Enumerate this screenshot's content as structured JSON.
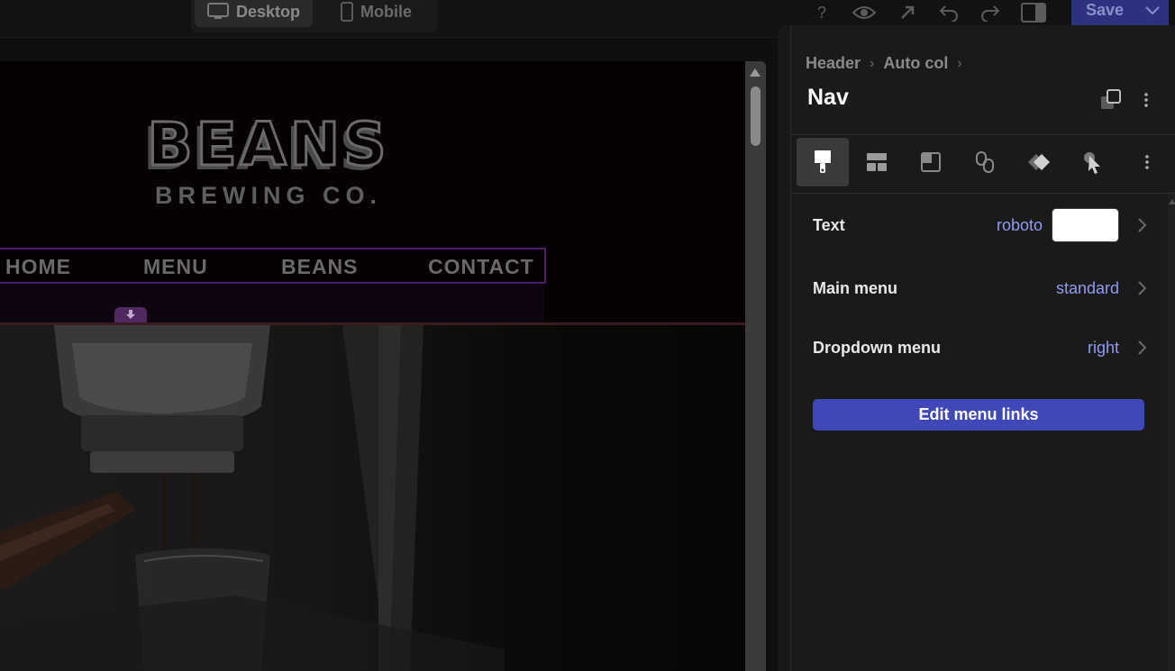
{
  "toolbar": {
    "desktop_label": "Desktop",
    "mobile_label": "Mobile",
    "help_label": "?",
    "save_label": "Save"
  },
  "site": {
    "logo_main": "BEANS",
    "logo_sub": "BREWING CO.",
    "nav": [
      "HOME",
      "MENU",
      "BEANS",
      "CONTACT"
    ]
  },
  "panel": {
    "breadcrumb": [
      "Header",
      "Auto col"
    ],
    "title": "Nav",
    "properties": [
      {
        "label": "Text",
        "value": "roboto",
        "swatch": "#ffffff"
      },
      {
        "label": "Main menu",
        "value": "standard"
      },
      {
        "label": "Dropdown menu",
        "value": "right"
      }
    ],
    "edit_button": "Edit menu links"
  },
  "colors": {
    "accent": "#4048b8",
    "selection": "#4a1d6a",
    "link_value": "#8f9cf0"
  },
  "icons": [
    "desktop-icon",
    "mobile-icon",
    "help-icon",
    "eye-icon",
    "external-link-icon",
    "undo-icon",
    "redo-icon",
    "sidebar-toggle-icon",
    "chevron-down-icon",
    "duplicate-icon",
    "more-vertical-icon",
    "paintbrush-icon",
    "layout-icon",
    "background-icon",
    "link-icon",
    "effects-icon",
    "pointer-icon"
  ]
}
